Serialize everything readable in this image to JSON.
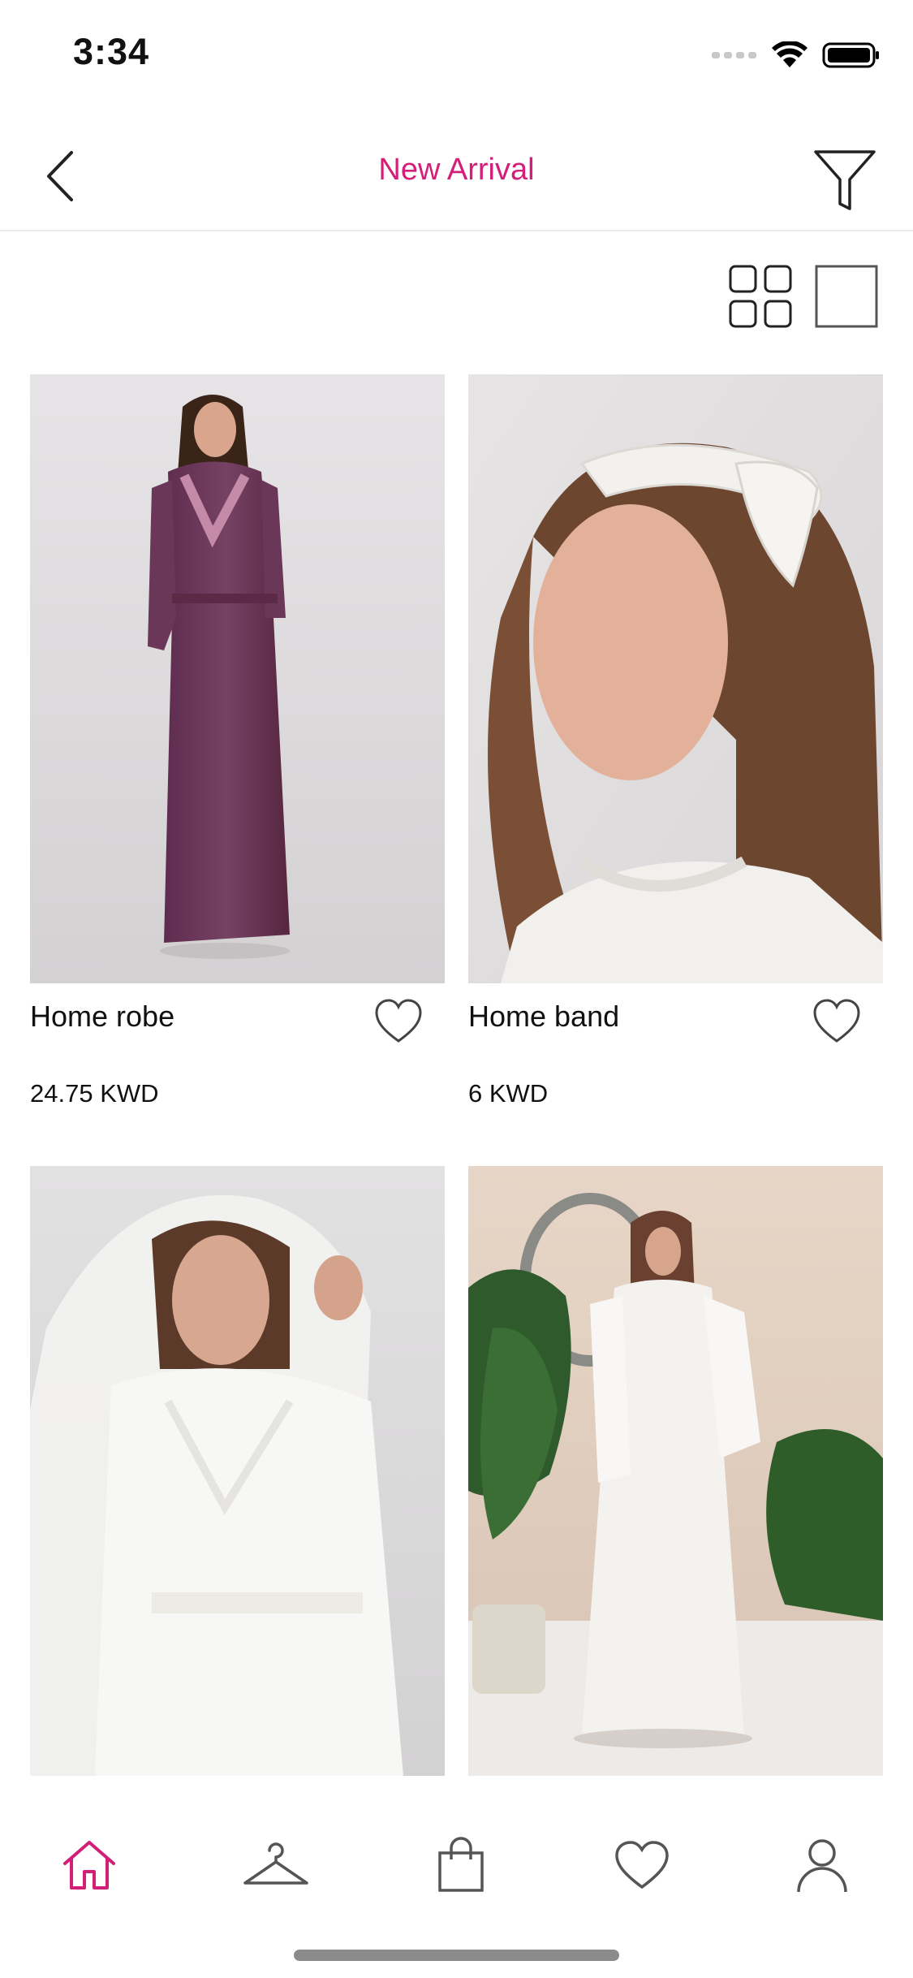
{
  "status_bar": {
    "time": "3:34",
    "icons": [
      "cellular-signal-icon",
      "wifi-icon",
      "battery-icon"
    ]
  },
  "nav": {
    "title": "New Arrival",
    "back_icon": "chevron-left-icon",
    "filter_icon": "filter-funnel-icon",
    "accent_color": "#d31f78"
  },
  "view_toggles": [
    "grid-view-icon",
    "single-view-icon"
  ],
  "products": [
    {
      "name": "Home robe",
      "price": "24.75 KWD",
      "favorite_icon": "heart-outline-icon",
      "image": "woman in purple robe with lace trim"
    },
    {
      "name": "Home band",
      "price": "6 KWD",
      "favorite_icon": "heart-outline-icon",
      "image": "woman wearing white lace headband"
    },
    {
      "name": "",
      "price": "",
      "favorite_icon": "",
      "image": "woman in white veil and white robe"
    },
    {
      "name": "",
      "price": "",
      "favorite_icon": "",
      "image": "woman in white satin gown with robe beside plants"
    }
  ],
  "tab_bar": {
    "items": [
      {
        "icon": "home-icon",
        "active": true
      },
      {
        "icon": "hanger-icon",
        "active": false
      },
      {
        "icon": "shopping-bag-icon",
        "active": false
      },
      {
        "icon": "heart-icon",
        "active": false
      },
      {
        "icon": "profile-icon",
        "active": false
      }
    ],
    "active_color": "#d31f78",
    "inactive_color": "#555555"
  }
}
